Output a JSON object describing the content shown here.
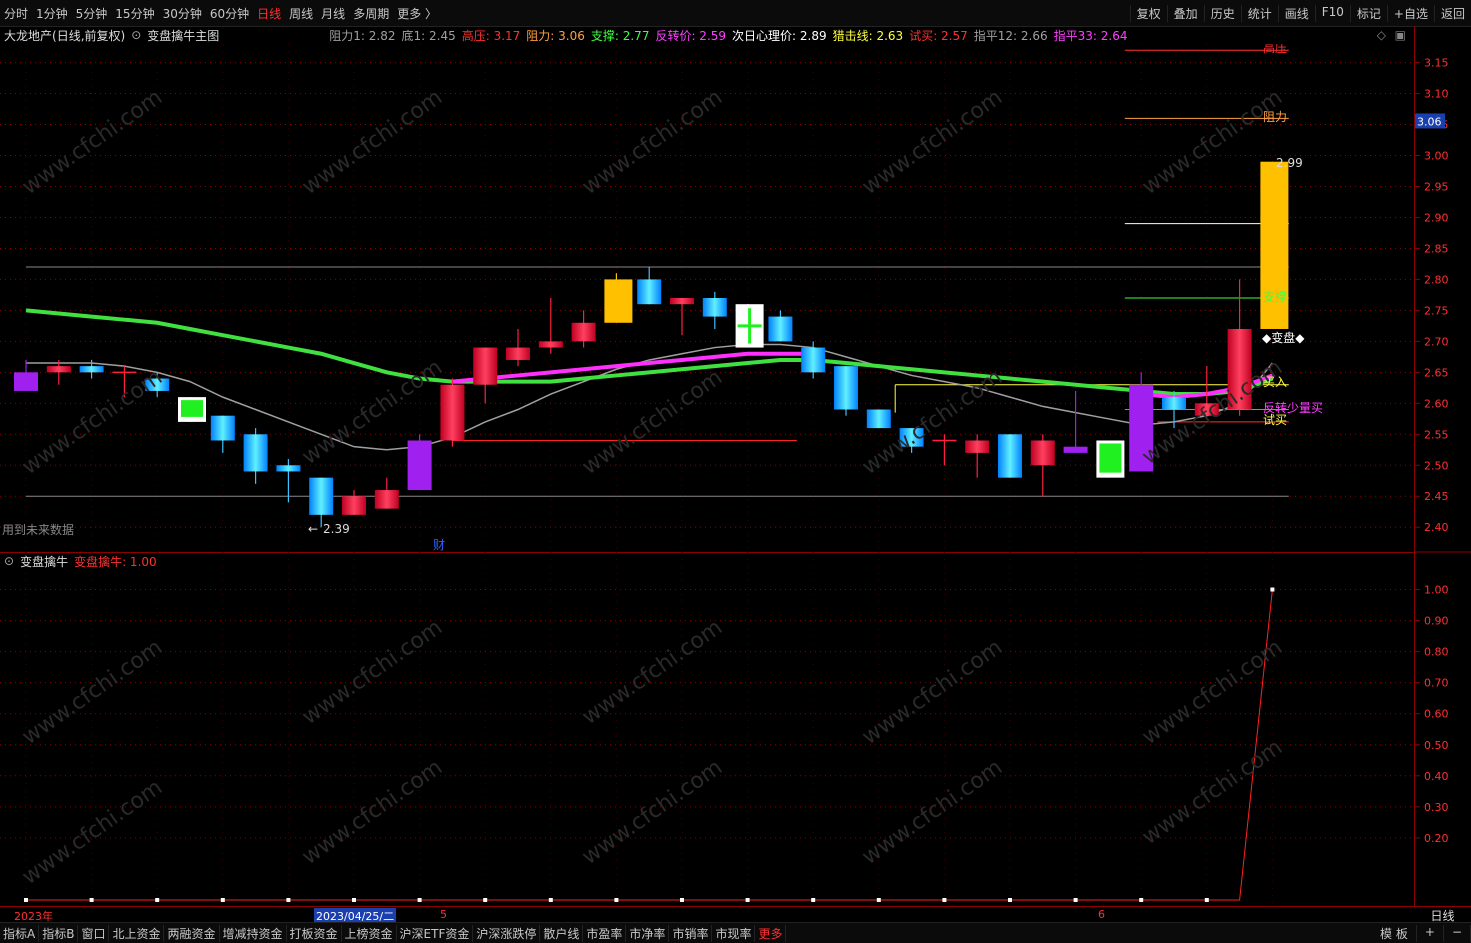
{
  "toolbar": {
    "periods": [
      "分时",
      "1分钟",
      "5分钟",
      "15分钟",
      "30分钟",
      "60分钟",
      "日线",
      "周线",
      "月线",
      "多周期",
      "更多 〉"
    ],
    "active_period": "日线",
    "actions": [
      "复权",
      "叠加",
      "历史",
      "统计",
      "画线",
      "F10",
      "标记",
      "+自选",
      "返回"
    ]
  },
  "info": {
    "stock": "大龙地产",
    "mode": "(日线,前复权)",
    "indicator": "变盘擒牛主图",
    "items": [
      {
        "label": "阻力1: 2.82",
        "color": "#a0a0a0"
      },
      {
        "label": "底1: 2.45",
        "color": "#a0a0a0"
      },
      {
        "label": "高压: 3.17",
        "color": "#ff3030"
      },
      {
        "label": "阻力: 3.06",
        "color": "#ffa040"
      },
      {
        "label": "支撑: 2.77",
        "color": "#40ff40"
      },
      {
        "label": "反转价: 2.59",
        "color": "#ff40ff"
      },
      {
        "label": "次日心理价: 2.89",
        "color": "#ffffff"
      },
      {
        "label": "猎击线: 2.63",
        "color": "#ffff40"
      },
      {
        "label": "试买: 2.57",
        "color": "#ff3030"
      },
      {
        "label": "指平12: 2.66",
        "color": "#a0a0a0"
      },
      {
        "label": "指平33: 2.64",
        "color": "#ff40ff"
      }
    ]
  },
  "sub_header": {
    "name": "变盘擒牛",
    "value_label": "变盘擒牛: 1.00"
  },
  "annotations": {
    "future_data": "用到未来数据",
    "low_label": "2.39",
    "high_label": "2.99",
    "cai": "财",
    "pressure": "高压",
    "resistance": "阻力",
    "support": "支撑",
    "change": "◆变盘◆",
    "buy": "买入",
    "reverse_buy": "反转少量买",
    "trial_buy": "试买"
  },
  "axis": {
    "price_ticks": [
      "3.15",
      "3.10",
      "3.05",
      "3.00",
      "2.95",
      "2.90",
      "2.85",
      "2.80",
      "2.75",
      "2.70",
      "2.65",
      "2.60",
      "2.55",
      "2.50",
      "2.45",
      "2.40"
    ],
    "current_price": "3.06",
    "sub_ticks": [
      "1.00",
      "0.90",
      "0.80",
      "0.70",
      "0.60",
      "0.50",
      "0.40",
      "0.30",
      "0.20"
    ]
  },
  "dates": {
    "year": "2023年",
    "cursor": "2023/04/25/二",
    "m5": "5",
    "m6": "6"
  },
  "day_label": "日线",
  "tabs": [
    "指标A",
    "指标B",
    "窗口",
    "北上资金",
    "两融资金",
    "增减持资金",
    "打板资金",
    "上榜资金",
    "沪深ETF资金",
    "沪深涨跌停",
    "散户线",
    "市盈率",
    "市净率",
    "市销率",
    "市现率",
    "更多"
  ],
  "tabs_right": [
    "模 板",
    "+",
    "−"
  ],
  "watermark": "www.cfchi.com",
  "chart_data": {
    "type": "candlestick",
    "ylim": [
      2.36,
      3.18
    ],
    "candles": [
      {
        "o": 2.65,
        "c": 2.62,
        "h": 2.67,
        "l": 2.62,
        "t": "purple"
      },
      {
        "o": 2.65,
        "c": 2.66,
        "h": 2.67,
        "l": 2.63,
        "t": "red"
      },
      {
        "o": 2.66,
        "c": 2.65,
        "h": 2.67,
        "l": 2.64,
        "t": "blue"
      },
      {
        "o": 2.65,
        "c": 2.65,
        "h": 2.66,
        "l": 2.61,
        "t": "cross"
      },
      {
        "o": 2.64,
        "c": 2.62,
        "h": 2.65,
        "l": 2.61,
        "t": "blue"
      },
      {
        "o": 2.61,
        "c": 2.57,
        "h": 2.61,
        "l": 2.57,
        "t": "green"
      },
      {
        "o": 2.58,
        "c": 2.54,
        "h": 2.58,
        "l": 2.52,
        "t": "blue"
      },
      {
        "o": 2.55,
        "c": 2.49,
        "h": 2.56,
        "l": 2.47,
        "t": "blue"
      },
      {
        "o": 2.5,
        "c": 2.49,
        "h": 2.51,
        "l": 2.44,
        "t": "blue"
      },
      {
        "o": 2.48,
        "c": 2.42,
        "h": 2.48,
        "l": 2.4,
        "t": "blue"
      },
      {
        "o": 2.42,
        "c": 2.45,
        "h": 2.46,
        "l": 2.42,
        "t": "red"
      },
      {
        "o": 2.43,
        "c": 2.46,
        "h": 2.48,
        "l": 2.43,
        "t": "red"
      },
      {
        "o": 2.46,
        "c": 2.54,
        "h": 2.55,
        "l": 2.46,
        "t": "purple"
      },
      {
        "o": 2.54,
        "c": 2.63,
        "h": 2.64,
        "l": 2.53,
        "t": "red"
      },
      {
        "o": 2.63,
        "c": 2.69,
        "h": 2.69,
        "l": 2.6,
        "t": "red"
      },
      {
        "o": 2.67,
        "c": 2.69,
        "h": 2.72,
        "l": 2.66,
        "t": "red"
      },
      {
        "o": 2.69,
        "c": 2.7,
        "h": 2.77,
        "l": 2.68,
        "t": "red"
      },
      {
        "o": 2.7,
        "c": 2.73,
        "h": 2.75,
        "l": 2.69,
        "t": "red"
      },
      {
        "o": 2.73,
        "c": 2.8,
        "h": 2.81,
        "l": 2.73,
        "t": "yellow"
      },
      {
        "o": 2.8,
        "c": 2.76,
        "h": 2.82,
        "l": 2.76,
        "t": "blue"
      },
      {
        "o": 2.76,
        "c": 2.77,
        "h": 2.77,
        "l": 2.71,
        "t": "red"
      },
      {
        "o": 2.77,
        "c": 2.74,
        "h": 2.78,
        "l": 2.72,
        "t": "blue"
      },
      {
        "o": 2.69,
        "c": 2.76,
        "h": 2.76,
        "l": 2.69,
        "t": "white"
      },
      {
        "o": 2.74,
        "c": 2.7,
        "h": 2.75,
        "l": 2.7,
        "t": "blue"
      },
      {
        "o": 2.69,
        "c": 2.65,
        "h": 2.7,
        "l": 2.64,
        "t": "blue"
      },
      {
        "o": 2.66,
        "c": 2.59,
        "h": 2.66,
        "l": 2.58,
        "t": "blue"
      },
      {
        "o": 2.59,
        "c": 2.56,
        "h": 2.59,
        "l": 2.56,
        "t": "blue"
      },
      {
        "o": 2.56,
        "c": 2.53,
        "h": 2.56,
        "l": 2.52,
        "t": "blue"
      },
      {
        "o": 2.54,
        "c": 2.54,
        "h": 2.55,
        "l": 2.5,
        "t": "cross"
      },
      {
        "o": 2.52,
        "c": 2.54,
        "h": 2.55,
        "l": 2.48,
        "t": "red"
      },
      {
        "o": 2.55,
        "c": 2.48,
        "h": 2.55,
        "l": 2.48,
        "t": "blue"
      },
      {
        "o": 2.5,
        "c": 2.54,
        "h": 2.55,
        "l": 2.45,
        "t": "red"
      },
      {
        "o": 2.53,
        "c": 2.52,
        "h": 2.62,
        "l": 2.52,
        "t": "purple"
      },
      {
        "o": 2.48,
        "c": 2.54,
        "h": 2.54,
        "l": 2.48,
        "t": "green"
      },
      {
        "o": 2.49,
        "c": 2.63,
        "h": 2.65,
        "l": 2.49,
        "t": "purple"
      },
      {
        "o": 2.61,
        "c": 2.59,
        "h": 2.62,
        "l": 2.56,
        "t": "blue"
      },
      {
        "o": 2.58,
        "c": 2.6,
        "h": 2.66,
        "l": 2.58,
        "t": "red"
      },
      {
        "o": 2.59,
        "c": 2.72,
        "h": 2.8,
        "l": 2.58,
        "t": "red"
      },
      {
        "o": 2.72,
        "c": 2.99,
        "h": 2.99,
        "l": 2.72,
        "t": "yellow"
      }
    ],
    "ma_green": [
      2.75,
      2.745,
      2.74,
      2.735,
      2.73,
      2.72,
      2.71,
      2.7,
      2.69,
      2.68,
      2.665,
      2.65,
      2.64,
      2.635,
      2.635,
      2.635,
      2.635,
      2.64,
      2.645,
      2.65,
      2.655,
      2.66,
      2.665,
      2.67,
      2.67,
      2.665,
      2.66,
      2.655,
      2.65,
      2.645,
      2.64,
      2.635,
      2.63,
      2.625,
      2.62,
      2.615,
      2.615,
      2.62,
      2.64
    ],
    "ma_magenta": [
      null,
      null,
      null,
      null,
      null,
      null,
      null,
      null,
      null,
      null,
      null,
      null,
      null,
      2.635,
      2.64,
      2.645,
      2.65,
      2.655,
      2.66,
      2.665,
      2.67,
      2.675,
      2.68,
      2.68,
      2.68,
      null,
      null,
      null,
      null,
      null,
      null,
      null,
      null,
      null,
      2.615,
      2.61,
      2.615,
      2.625,
      2.645
    ],
    "ma_gray": [
      2.665,
      2.665,
      2.665,
      2.66,
      2.65,
      2.635,
      2.61,
      2.59,
      2.57,
      2.55,
      2.53,
      2.525,
      2.53,
      2.545,
      2.57,
      2.59,
      2.615,
      2.635,
      2.655,
      2.67,
      2.68,
      2.69,
      2.695,
      2.695,
      2.69,
      2.675,
      2.66,
      2.645,
      2.635,
      2.625,
      2.61,
      2.595,
      2.585,
      2.575,
      2.565,
      2.57,
      2.58,
      2.6,
      2.665
    ],
    "hlines": [
      {
        "y": 2.82,
        "x0": 0,
        "x1": 38.5,
        "color": "#888888"
      },
      {
        "y": 2.45,
        "x0": 0,
        "x1": 38.5,
        "color": "#888888"
      },
      {
        "y": 2.54,
        "x0": 13,
        "x1": 23.5,
        "color": "#ff2020"
      },
      {
        "y": 3.17,
        "x0": 33.5,
        "x1": 38.5,
        "color": "#ff3030"
      },
      {
        "y": 3.06,
        "x0": 33.5,
        "x1": 38.5,
        "color": "#ffa040"
      },
      {
        "y": 2.89,
        "x0": 33.5,
        "x1": 38.5,
        "color": "#ffffff"
      },
      {
        "y": 2.77,
        "x0": 33.5,
        "x1": 38.5,
        "color": "#40ff40"
      },
      {
        "y": 2.63,
        "x0": 26.5,
        "x1": 38.5,
        "color": "#ffff40"
      },
      {
        "y": 2.59,
        "x0": 33.5,
        "x1": 38.5,
        "color": "#ff40ff"
      },
      {
        "y": 2.57,
        "x0": 34.5,
        "x1": 38.5,
        "color": "#ff3030"
      }
    ],
    "sub": {
      "ylim": [
        0,
        1.05
      ],
      "values": [
        0,
        0,
        0,
        0,
        0,
        0,
        0,
        0,
        0,
        0,
        0,
        0,
        0,
        0,
        0,
        0,
        0,
        0,
        0,
        0,
        0,
        0,
        0,
        0,
        0,
        0,
        0,
        0,
        0,
        0,
        0,
        0,
        0,
        0,
        0,
        0,
        0,
        0,
        1.0
      ]
    }
  }
}
